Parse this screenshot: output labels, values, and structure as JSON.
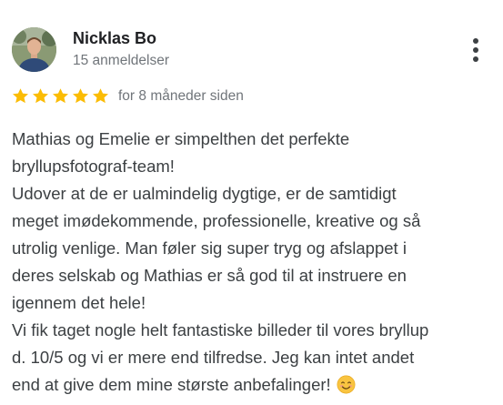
{
  "review": {
    "author": {
      "name": "Nicklas Bo",
      "review_count": "15 anmeldelser",
      "avatar": "profile-photo"
    },
    "rating": {
      "stars": 5,
      "max": 5,
      "color": "#fbbc04"
    },
    "time": "for 8 måneder siden",
    "text_lines": [
      "Mathias og Emelie er simpelthen det perfekte",
      "bryllupsfotograf-team!",
      "Udover at de er ualmindelig dygtige, er de samtidigt",
      "meget imødekommende, professionelle, kreative og så",
      "utrolig venlige. Man føler sig super tryg og afslappet i",
      "deres selskab og Mathias er så god til at instruere en",
      "igennem det hele!",
      "Vi fik taget nogle helt fantastiske billeder til vores bryllup",
      "d. 10/5 og vi er mere end tilfredse. Jeg kan intet andet",
      "end at give dem mine største anbefalinger!"
    ],
    "trailing_emoji": "smiling-face-emoji",
    "more_menu_icon": "more-vert-icon"
  }
}
